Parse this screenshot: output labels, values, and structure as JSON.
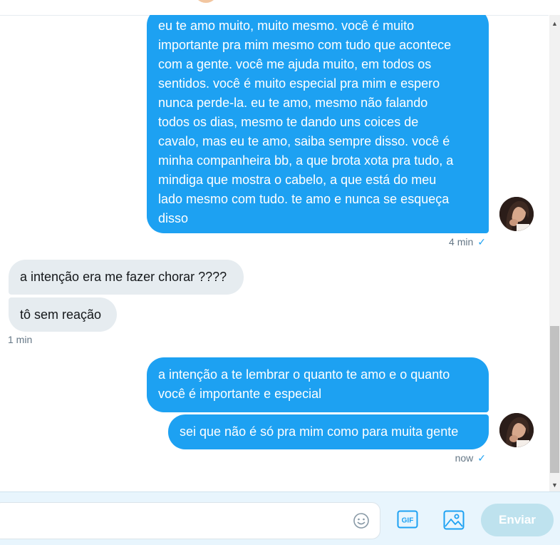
{
  "messages": [
    {
      "direction": "sent",
      "text": "eu te amo muito, muito mesmo. você é muito\nimportante pra mim mesmo com tudo que acontece\ncom a gente. você me ajuda muito, em todos os\nsentidos. você é muito especial pra mim e espero\nnunca perde-la. eu te amo, mesmo não falando\ntodos os dias, mesmo te dando uns coices de\ncavalo, mas eu te amo, saiba sempre disso. você é\nminha companheira bb, a que brota xota pra tudo, a\nmindiga que mostra o cabelo, a que está do meu\nlado mesmo com tudo. te amo e nunca se esqueça\ndisso"
    },
    {
      "direction": "received",
      "text": "a intenção era me fazer chorar ????"
    },
    {
      "direction": "received",
      "text": "tô sem reação"
    },
    {
      "direction": "sent",
      "text": "a intenção a te lembrar o quanto te amo e o quanto\nvocê é importante e especial"
    },
    {
      "direction": "sent",
      "text": "sei que não é só pra mim como para muita gente"
    }
  ],
  "timestamps": {
    "first_sent": "4 min",
    "received": "1 min",
    "last_sent": "now",
    "read_check": "✓"
  },
  "composer": {
    "send_label": "Enviar",
    "gif_label": "GIF",
    "emoji_icon": "emoji-icon",
    "media_icon": "image-icon"
  },
  "colors": {
    "sent_bubble": "#1da1f2",
    "received_bubble": "#e6ecf0",
    "send_button_disabled": "#bee2ee",
    "composer_background": "#e8f5fd",
    "accent": "#1da1f2"
  }
}
